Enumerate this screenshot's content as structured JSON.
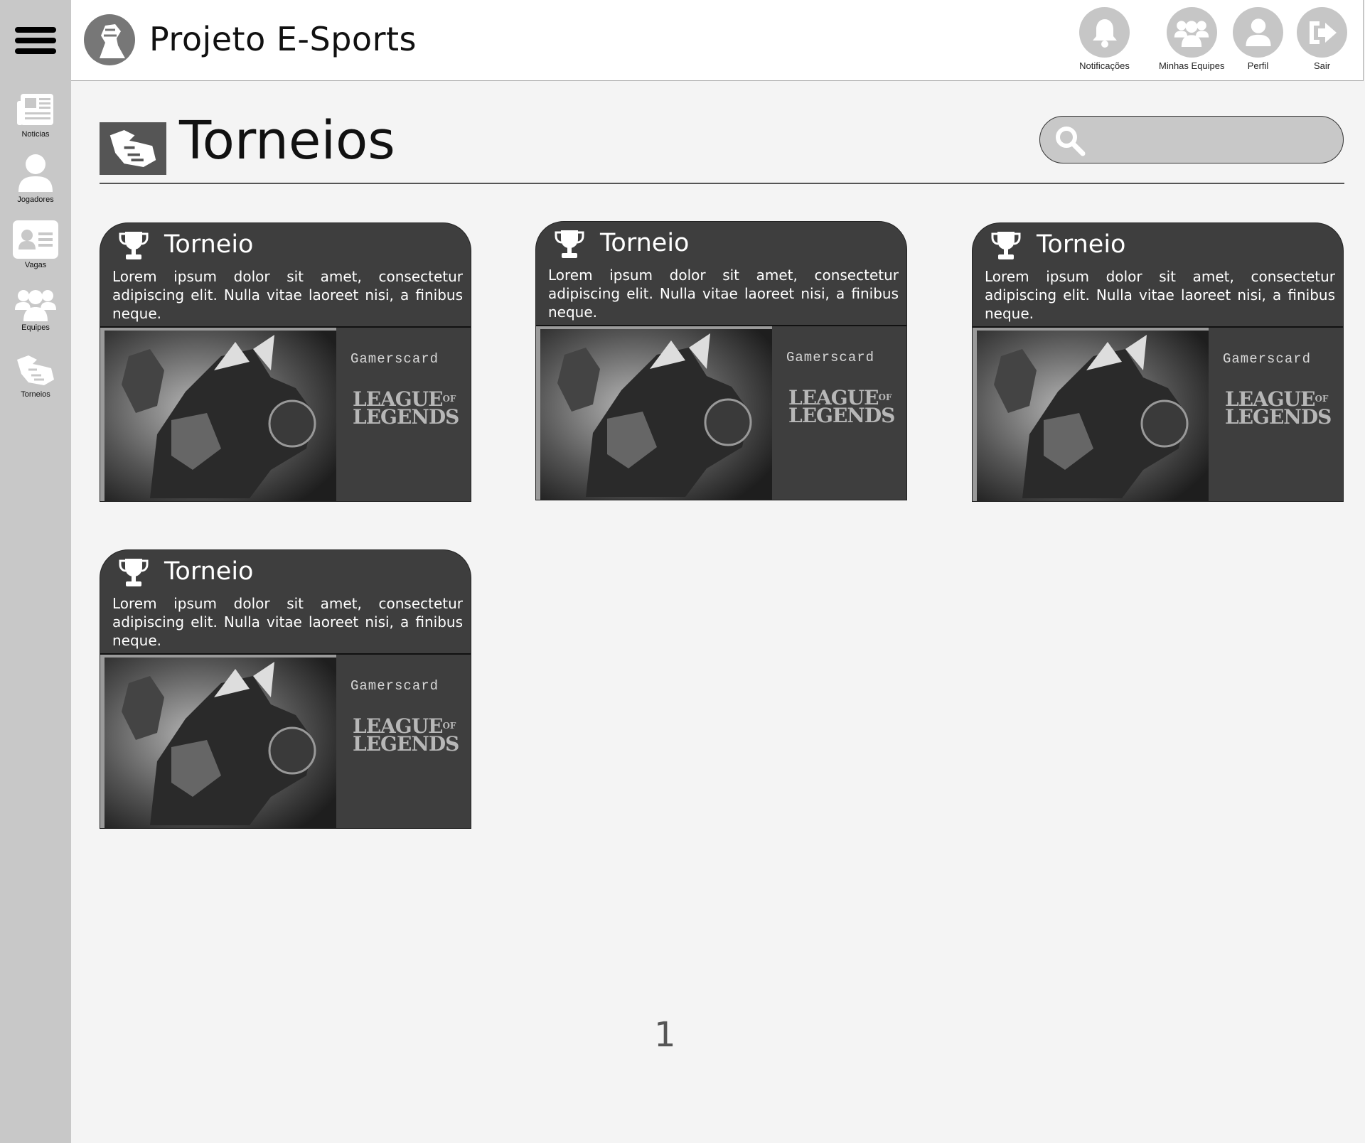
{
  "app": {
    "title": "Projeto E-Sports"
  },
  "header_actions": [
    {
      "label": "Notificações",
      "icon": "bell-icon"
    },
    {
      "label": "Minhas Equipes",
      "icon": "team-icon"
    },
    {
      "label": "Perfil",
      "icon": "user-icon"
    },
    {
      "label": "Sair",
      "icon": "logout-icon"
    }
  ],
  "sidebar": {
    "items": [
      {
        "label": "Noticias",
        "icon": "newspaper-icon",
        "active": false
      },
      {
        "label": "Jogadores",
        "icon": "player-icon",
        "active": false
      },
      {
        "label": "Vagas",
        "icon": "id-card-icon",
        "active": true
      },
      {
        "label": "Equipes",
        "icon": "team-icon",
        "active": false
      },
      {
        "label": "Torneios",
        "icon": "handshake-icon",
        "active": false
      }
    ]
  },
  "page": {
    "title": "Torneios",
    "search_placeholder": ""
  },
  "cards": [
    {
      "title": "Torneio",
      "description": "Lorem ipsum dolor sit amet, consectetur adipiscing elit. Nulla vitae laoreet nisi, a finibus neque.",
      "sponsor": "Gamerscard",
      "game_logo_line1": "LEAGUE",
      "game_logo_of": "OF",
      "game_logo_line2": "LEGENDS"
    },
    {
      "title": "Torneio",
      "description": "Lorem ipsum dolor sit amet, consectetur adipiscing elit. Nulla vitae laoreet nisi, a finibus neque.",
      "sponsor": "Gamerscard",
      "game_logo_line1": "LEAGUE",
      "game_logo_of": "OF",
      "game_logo_line2": "LEGENDS"
    },
    {
      "title": "Torneio",
      "description": "Lorem ipsum dolor sit amet, consectetur adipiscing elit. Nulla vitae laoreet nisi, a finibus neque.",
      "sponsor": "Gamerscard",
      "game_logo_line1": "LEAGUE",
      "game_logo_of": "OF",
      "game_logo_line2": "LEGENDS"
    },
    {
      "title": "Torneio",
      "description": "Lorem ipsum dolor sit amet, consectetur adipiscing elit. Nulla vitae laoreet nisi, a finibus neque.",
      "sponsor": "Gamerscard",
      "game_logo_line1": "LEAGUE",
      "game_logo_of": "OF",
      "game_logo_line2": "LEGENDS"
    }
  ],
  "pagination": {
    "current_page": "1"
  },
  "colors": {
    "sidebar_bg": "#c8c8c8",
    "card_bg": "#3e3e3e",
    "page_bg": "#f4f4f4"
  }
}
